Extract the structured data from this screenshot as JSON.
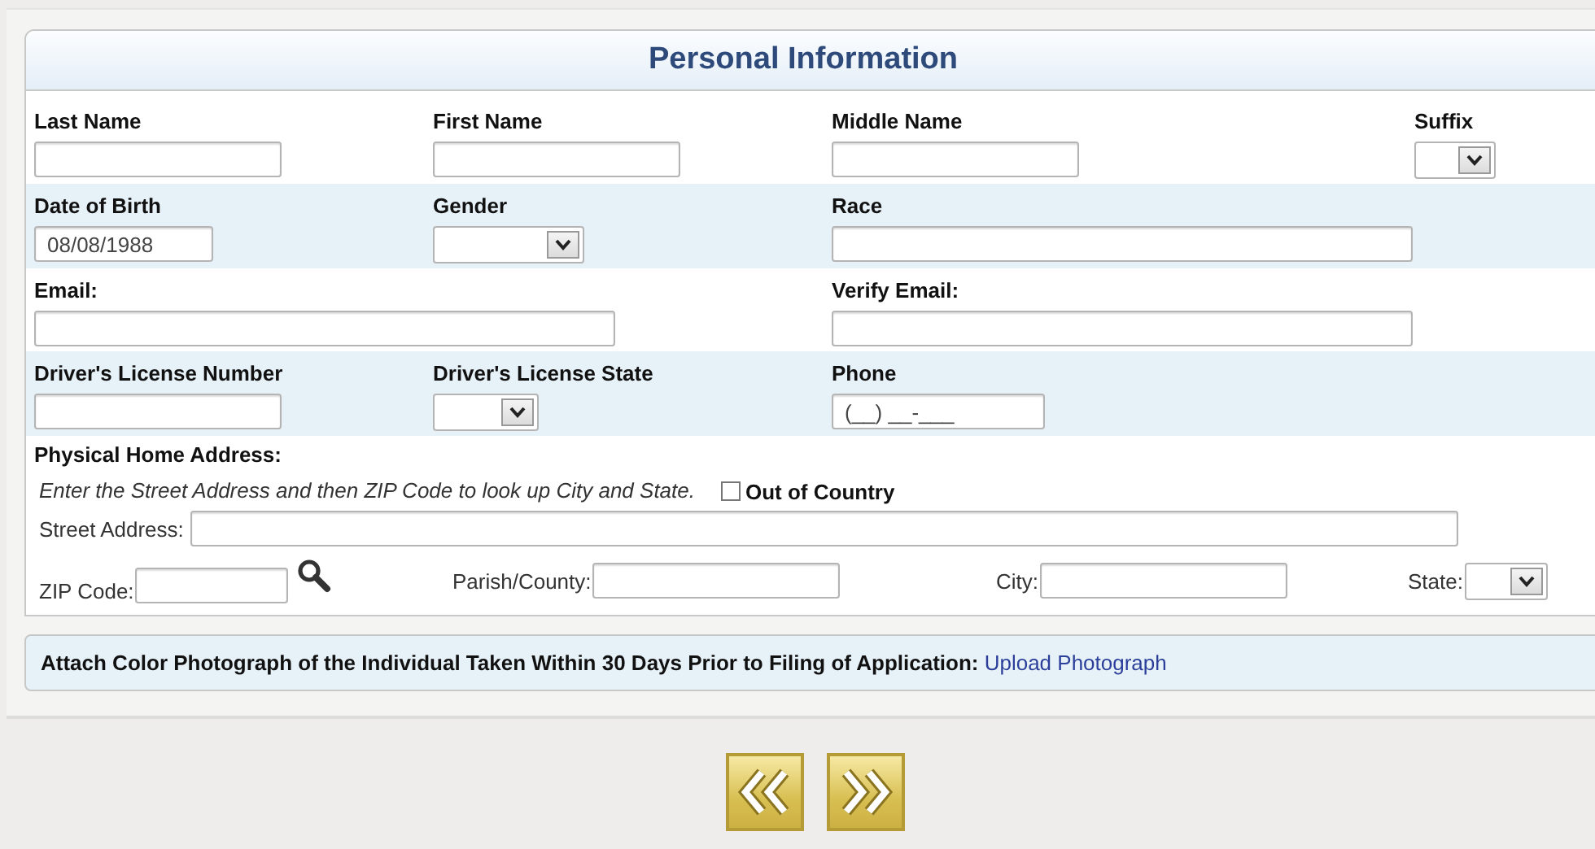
{
  "header": {
    "title": "Personal Information"
  },
  "rows": [
    {
      "fields": [
        {
          "label": "Last Name",
          "kind": "text"
        },
        {
          "label": "First Name",
          "kind": "text"
        },
        {
          "label": "Middle Name",
          "kind": "text"
        },
        {
          "label": "Suffix",
          "kind": "select"
        }
      ]
    },
    {
      "fields": [
        {
          "label": "Date of Birth",
          "kind": "text",
          "value": "08/08/1988"
        },
        {
          "label": "Gender",
          "kind": "select"
        },
        {
          "label": "Race",
          "kind": "text"
        }
      ]
    },
    {
      "fields": [
        {
          "label": "Email:",
          "kind": "text"
        },
        {
          "label": "Verify Email:",
          "kind": "text"
        }
      ]
    },
    {
      "fields": [
        {
          "label": "Driver's License Number",
          "kind": "text"
        },
        {
          "label": "Driver's License State",
          "kind": "select"
        },
        {
          "label": "Phone",
          "kind": "text",
          "value": "(__) __-___"
        }
      ]
    }
  ],
  "address": {
    "heading": "Physical Home Address:",
    "hint": "Enter the Street Address and then ZIP Code to look up City and State.",
    "out_of_country": {
      "label": "Out of Country",
      "checked": false
    },
    "street": {
      "label": "Street Address:"
    },
    "fields": [
      {
        "label": "ZIP Code:",
        "kind": "zip"
      },
      {
        "label": "Parish/County:",
        "kind": "text"
      },
      {
        "label": "City:",
        "kind": "text"
      },
      {
        "label": "State:",
        "kind": "select"
      }
    ]
  },
  "attach": {
    "text": "Attach Color Photograph of the Individual Taken Within 30 Days Prior to Filing of Application:",
    "link": "Upload Photograph"
  },
  "nav_buttons": [
    {
      "kind": "back"
    },
    {
      "kind": "forward"
    }
  ]
}
